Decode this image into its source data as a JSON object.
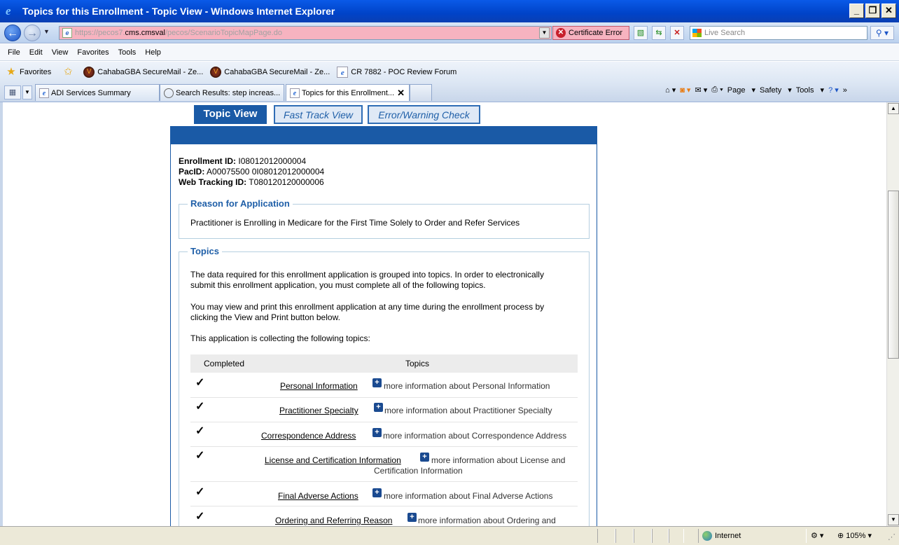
{
  "window": {
    "title": "Topics for this Enrollment - Topic View - Windows Internet Explorer"
  },
  "address": {
    "url_prefix": "https://pecos7.",
    "url_host": "cms.cmsval",
    "url_suffix": "/pecos/ScenarioTopicMapPage.do",
    "cert_error": "Certificate Error",
    "search_placeholder": "Live Search"
  },
  "menu": [
    "File",
    "Edit",
    "View",
    "Favorites",
    "Tools",
    "Help"
  ],
  "favorites": {
    "label": "Favorites",
    "items": [
      "CahabaGBA SecureMail - Ze...",
      "CahabaGBA SecureMail - Ze...",
      "CR 7882 - POC Review Forum"
    ]
  },
  "tabs": [
    "ADI Services Summary",
    "Search Results: step increas...",
    "Topics for this Enrollment..."
  ],
  "commands": [
    "Page",
    "Safety",
    "Tools"
  ],
  "page_tabs": {
    "topic_view": "Topic View",
    "fast_track": "Fast Track View",
    "error_check": "Error/Warning Check"
  },
  "ids": {
    "enrollment_label": "Enrollment ID:",
    "enrollment_value": "I08012012000004",
    "pac_label": "PacID:",
    "pac_value": "A00075500 0I08012012000004",
    "web_label": "Web Tracking ID:",
    "web_value": "T080120120000006"
  },
  "reason": {
    "legend": "Reason for Application",
    "text": "Practitioner is Enrolling in Medicare for the First Time Solely to Order and Refer Services"
  },
  "topics": {
    "legend": "Topics",
    "p1a": "The data required for this enrollment application is grouped into topics. In order to electronically",
    "p1b": "submit this enrollment application, you must complete all of the following topics.",
    "p2a": "You may view and print this enrollment application at any time during the enrollment process by",
    "p2b": "clicking the View and Print button below.",
    "p3": "This application is collecting the following topics:",
    "col_completed": "Completed",
    "col_topics": "Topics",
    "rows": [
      {
        "check": "✓",
        "name": "Personal Information",
        "more": "more information about  Personal Information",
        "more2": ""
      },
      {
        "check": "✓",
        "name": "Practitioner Specialty",
        "more": "more information about  Practitioner Specialty",
        "more2": ""
      },
      {
        "check": "✓",
        "name": "Correspondence Address",
        "more": "more information about  Correspondence Address",
        "more2": ""
      },
      {
        "check": "✓",
        "name": "License and Certification Information",
        "more": "more information about  License and",
        "more2": "Certification Information"
      },
      {
        "check": "✓",
        "name": "Final Adverse Actions",
        "more": "more information about  Final Adverse Actions",
        "more2": ""
      },
      {
        "check": "✓",
        "name": "Ordering and Referring Reason",
        "more": "more information about  Ordering and",
        "more2": ""
      }
    ]
  },
  "status": {
    "zone": "Internet",
    "zoom": "105%"
  }
}
